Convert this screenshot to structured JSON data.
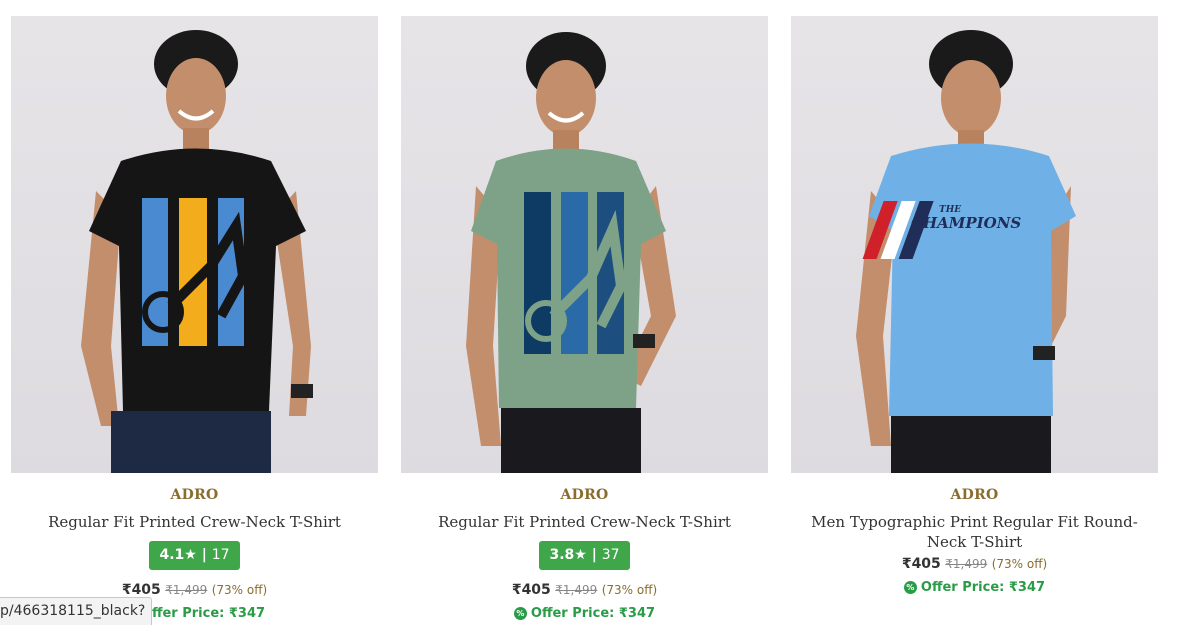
{
  "products": [
    {
      "brand": "ADRO",
      "title": "Regular Fit Printed Crew-Neck T-Shirt",
      "rating": "4.1",
      "star": "★",
      "rating_count": "17",
      "price": "₹405",
      "mrp": "₹1,499",
      "discount": "(73% off)",
      "offer_price": "Offer Price: ₹347",
      "shirt_color": "#151515",
      "jeans_color": "#1e2a44"
    },
    {
      "brand": "ADRO",
      "title": "Regular Fit Printed Crew-Neck T-Shirt",
      "rating": "3.8",
      "star": "★",
      "rating_count": "37",
      "price": "₹405",
      "mrp": "₹1,499",
      "discount": "(73% off)",
      "offer_price": "Offer Price: ₹347",
      "shirt_color": "#7ea288",
      "jeans_color": "#1a1a1e"
    },
    {
      "brand": "ADRO",
      "title": "Men Typographic Print Regular Fit Round-Neck T-Shirt",
      "price": "₹405",
      "mrp": "₹1,499",
      "discount": "(73% off)",
      "offer_price": "Offer Price: ₹347",
      "shirt_color": "#6fb1e6",
      "jeans_color": "#1a1a1e",
      "print_text": "CHAMPIONS",
      "print_small": "THE"
    }
  ],
  "colors": {
    "rating_bg": "#3fa749",
    "offer_green": "#2a9b47",
    "brand_gold": "#8a6d2e"
  },
  "status_bar": {
    "url": "p/466318115_black?"
  }
}
